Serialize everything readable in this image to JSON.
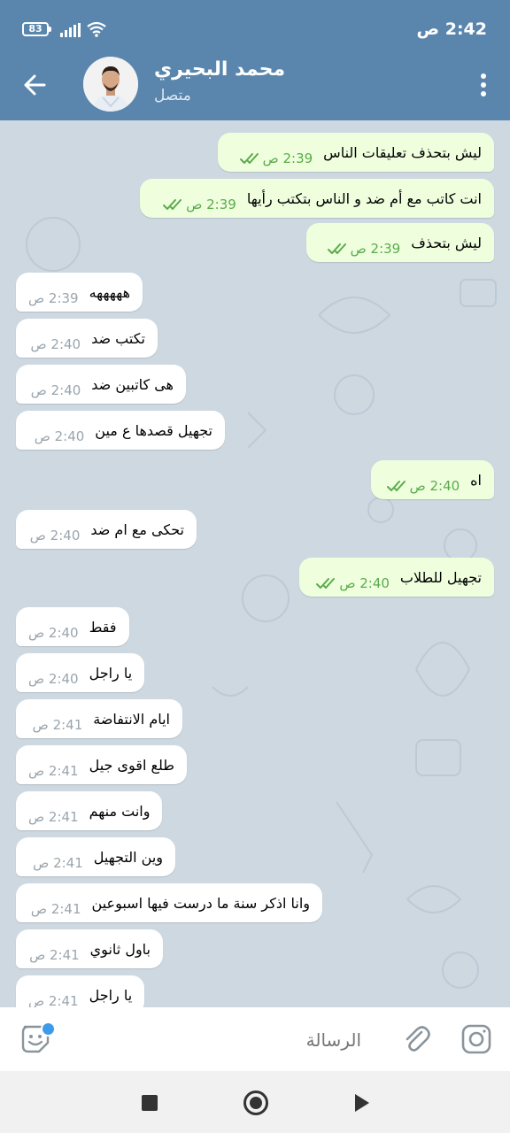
{
  "status_bar": {
    "battery": "83",
    "time": "2:42 ص"
  },
  "header": {
    "name": "محمد البحيري",
    "status": "متصل"
  },
  "messages": [
    {
      "dir": "out",
      "text": "ليش بتحذف تعليقات الناس",
      "time": "2:39 ص"
    },
    {
      "dir": "out",
      "text": "انت كاتب مع أم ضد و الناس بتكتب رأيها",
      "time": "2:39 ص"
    },
    {
      "dir": "out",
      "text": "ليش بتحذف",
      "time": "2:39 ص"
    },
    {
      "dir": "in",
      "text": "هههههه",
      "time": "2:39 ص"
    },
    {
      "dir": "in",
      "text": "تكتب ضد",
      "time": "2:40 ص"
    },
    {
      "dir": "in",
      "text": "هى كاتبين ضد",
      "time": "2:40 ص"
    },
    {
      "dir": "in",
      "text": "تجهيل قصدها ع مين",
      "time": "2:40 ص"
    },
    {
      "dir": "out",
      "text": "اه",
      "time": "2:40 ص"
    },
    {
      "dir": "in",
      "text": "تحكى مع ام ضد",
      "time": "2:40 ص"
    },
    {
      "dir": "out",
      "text": "تجهيل للطلاب",
      "time": "2:40 ص"
    },
    {
      "dir": "in",
      "text": "فقط",
      "time": "2:40 ص"
    },
    {
      "dir": "in",
      "text": "يا راجل",
      "time": "2:40 ص"
    },
    {
      "dir": "in",
      "text": "ايام الانتفاضة",
      "time": "2:41 ص"
    },
    {
      "dir": "in",
      "text": "طلع اقوى جيل",
      "time": "2:41 ص"
    },
    {
      "dir": "in",
      "text": "وانت منهم",
      "time": "2:41 ص"
    },
    {
      "dir": "in",
      "text": "وين التجهيل",
      "time": "2:41 ص"
    },
    {
      "dir": "in",
      "text": "وانا اذكر سنة ما درست فيها اسبوعين",
      "time": "2:41 ص"
    },
    {
      "dir": "in",
      "text": "باول ثانوي",
      "time": "2:41 ص"
    },
    {
      "dir": "in",
      "text": "يا راجل",
      "time": "2:41 ص"
    }
  ],
  "input": {
    "placeholder": "الرسالة"
  },
  "icons": {
    "back": "arrow-left-icon",
    "menu": "more-vertical-icon",
    "emoji": "sticker-emoji-icon",
    "attach": "paperclip-icon",
    "camera": "instagram-camera-icon",
    "ticks": "double-check-icon"
  },
  "colors": {
    "header": "#5a86ad",
    "outgoing_bubble": "#efffde",
    "incoming_bubble": "#ffffff",
    "chat_bg": "#cdd8e1",
    "ticks": "#5aab4b"
  }
}
